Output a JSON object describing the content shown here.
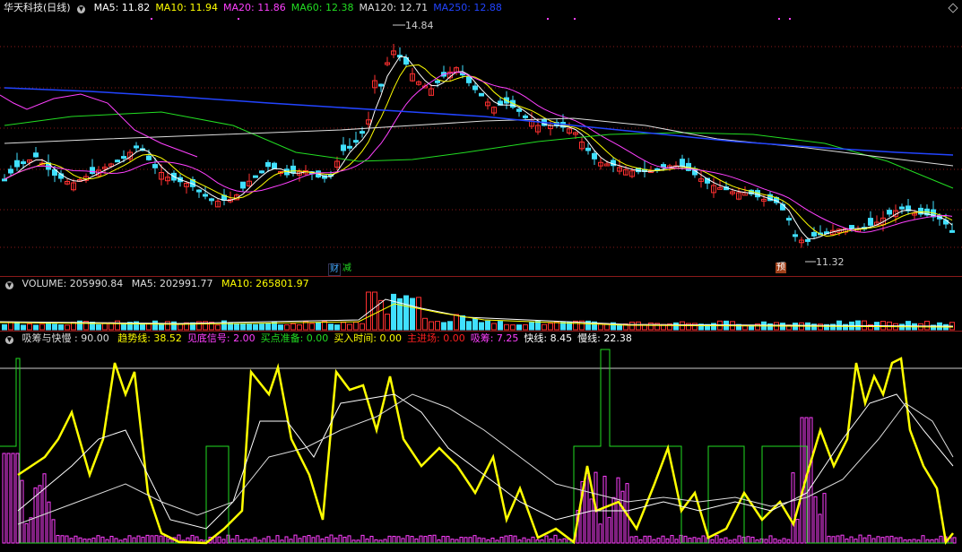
{
  "main": {
    "title": "华天科技(日线)",
    "ma": [
      {
        "label": "MA5: 11.82",
        "color": "#ffffff"
      },
      {
        "label": "MA10: 11.94",
        "color": "#ffff00"
      },
      {
        "label": "MA20: 11.86",
        "color": "#ff40ff"
      },
      {
        "label": "MA60: 12.38",
        "color": "#22dd22"
      },
      {
        "label": "MA120: 12.71",
        "color": "#dddddd"
      },
      {
        "label": "MA250: 12.88",
        "color": "#2244ff"
      }
    ],
    "high_label": "14.84",
    "low_label": "11.32",
    "tags": {
      "cai": "财",
      "jian": "减",
      "yu": "预"
    }
  },
  "volume": {
    "title": "VOLUME: 205990.84",
    "ma5": "MA5: 202991.77",
    "ma10": "MA10: 265801.97"
  },
  "indicator": {
    "name": "吸筹与快慢",
    "value": ": 90.00",
    "items": [
      {
        "label": "趋势线: 38.52",
        "color": "#ffff00"
      },
      {
        "label": "见底信号: 2.00",
        "color": "#ff40ff"
      },
      {
        "label": "买点准备: 0.00",
        "color": "#22dd22"
      },
      {
        "label": "买入时间: 0.00",
        "color": "#ffff00"
      },
      {
        "label": "主进场: 0.00",
        "color": "#ff2020"
      },
      {
        "label": "吸筹: 7.25",
        "color": "#ff40ff"
      },
      {
        "label": "快线: 8.45",
        "color": "#ffffff"
      },
      {
        "label": "慢线: 22.38",
        "color": "#ffffff"
      }
    ]
  },
  "colors": {
    "up": "#ff3030",
    "down": "#40e0ff",
    "grid": "#8b1a1a"
  }
}
